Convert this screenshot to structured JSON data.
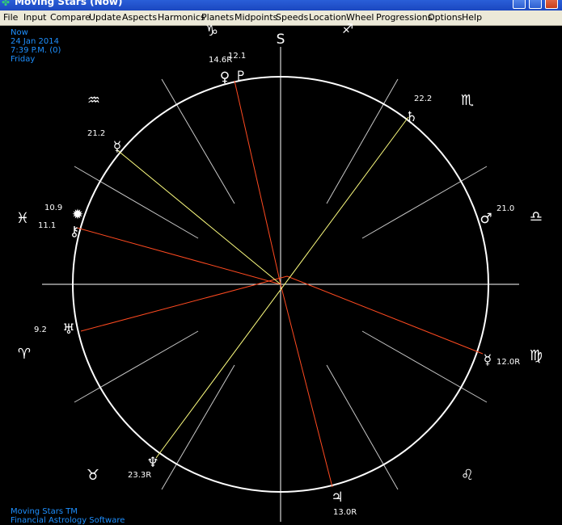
{
  "window": {
    "title": "Moving Stars (Now)",
    "app_icon": "✤"
  },
  "menu": [
    "File",
    "Input",
    "Compare",
    "Update",
    "Aspects",
    "Harmonics",
    "Planets",
    "Midpoints",
    "Speeds",
    "Location",
    "Wheel",
    "Progressions",
    "Options",
    "Help"
  ],
  "info": {
    "mode": "Now",
    "date": "24 Jan 2014",
    "time": "7:39 P.M. (0)",
    "weekday": "Friday"
  },
  "footer": {
    "line1": "Moving Stars TM",
    "line2": "Financial Astrology Software"
  },
  "colors": {
    "background": "#000000",
    "wheel": "#ffffff",
    "info_text": "#1e90ff",
    "line_red": "#ff4a20",
    "line_yellow": "#ffff80",
    "line_gray": "#c8c8c8"
  },
  "compass": {
    "south_label": "S"
  },
  "signs": [
    {
      "name": "capricorn",
      "glyph": "♑"
    },
    {
      "name": "sagittarius",
      "glyph": "♐"
    },
    {
      "name": "aquarius",
      "glyph": "♒"
    },
    {
      "name": "scorpio",
      "glyph": "♏"
    },
    {
      "name": "pisces",
      "glyph": "♓"
    },
    {
      "name": "libra",
      "glyph": "♎"
    },
    {
      "name": "aries",
      "glyph": "♈"
    },
    {
      "name": "virgo",
      "glyph": "♍"
    },
    {
      "name": "taurus",
      "glyph": "♉"
    },
    {
      "name": "leo",
      "glyph": "♌"
    }
  ],
  "planets": [
    {
      "name": "venus",
      "glyph": "♀",
      "degree": "14.6R"
    },
    {
      "name": "pluto",
      "glyph": "♇",
      "degree": "12.1"
    },
    {
      "name": "saturn",
      "glyph": "♄",
      "degree": "22.2"
    },
    {
      "name": "mercury",
      "glyph": "☿",
      "degree": "21.2"
    },
    {
      "name": "mars",
      "glyph": "♂",
      "degree": "21.0"
    },
    {
      "name": "sun",
      "glyph": "✹",
      "degree": "10.9"
    },
    {
      "name": "chiron",
      "glyph": "⚷",
      "degree": "11.1"
    },
    {
      "name": "uranus",
      "glyph": "♅",
      "degree": "9.2"
    },
    {
      "name": "moon",
      "glyph": "☿",
      "degree": "12.0R"
    },
    {
      "name": "neptune",
      "glyph": "♆",
      "degree": "23.3R"
    },
    {
      "name": "jupiter",
      "glyph": "♃",
      "degree": "13.0R"
    }
  ]
}
